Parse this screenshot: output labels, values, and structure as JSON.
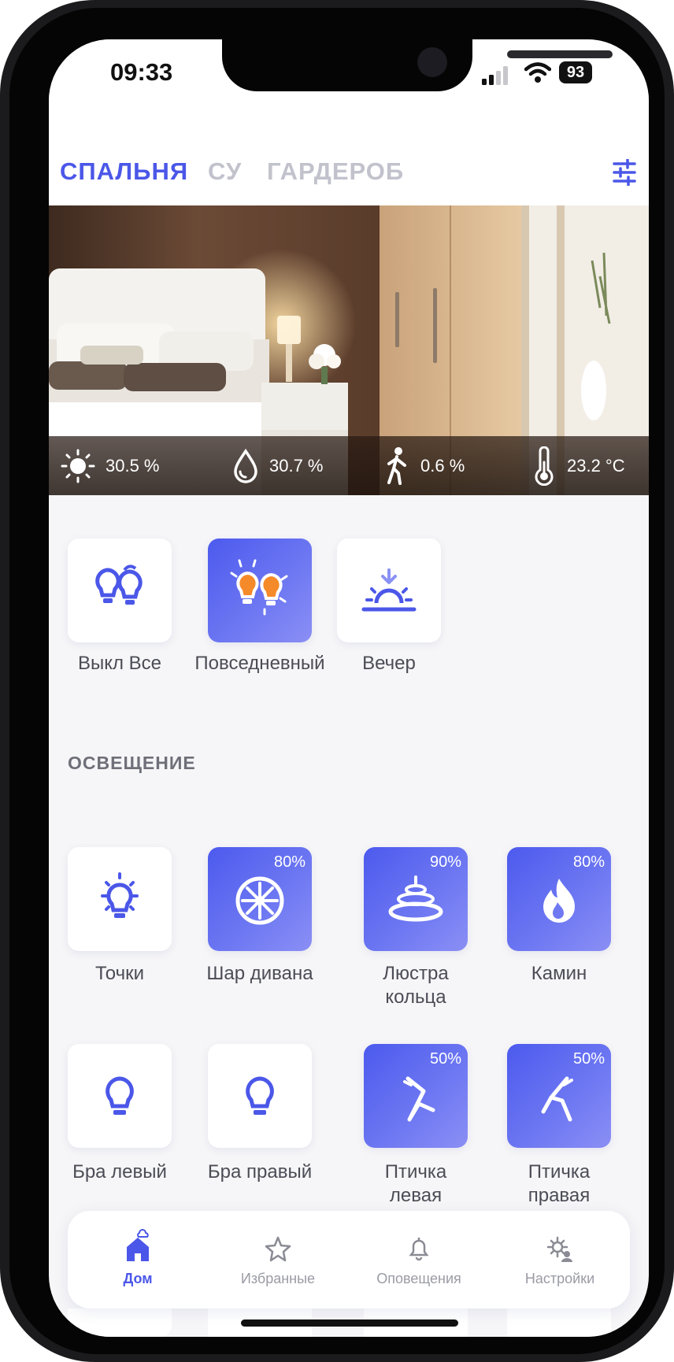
{
  "status_bar": {
    "time": "09:33",
    "battery": "93"
  },
  "tabs": [
    {
      "label": "СПАЛЬНЯ",
      "active": true
    },
    {
      "label": "СУ",
      "active": false
    },
    {
      "label": "ГАРДЕРОБ",
      "active": false
    }
  ],
  "sensors": [
    {
      "icon": "sun-icon",
      "value": "30.5 %"
    },
    {
      "icon": "drop-icon",
      "value": "30.7 %"
    },
    {
      "icon": "walking-person-icon",
      "value": "0.6 %"
    },
    {
      "icon": "thermometer-icon",
      "value": "23.2 °C"
    }
  ],
  "scenes": [
    {
      "icon": "bulbs-off-icon",
      "label": "Выкл Все",
      "active": false
    },
    {
      "icon": "bulbs-on-icon",
      "label": "Повседневный",
      "active": true
    },
    {
      "icon": "sunset-icon",
      "label": "Вечер",
      "active": false
    }
  ],
  "lighting_title": "ОСВЕЩЕНИЕ",
  "lights": [
    {
      "icon": "bulb-rays-icon",
      "label": "Точки",
      "level": "",
      "on": false
    },
    {
      "icon": "sphere-lamp-icon",
      "label": "Шар дивана",
      "level": "80%",
      "on": true
    },
    {
      "icon": "ring-chandelier-icon",
      "label": "Люстра кольца",
      "level": "90%",
      "on": true
    },
    {
      "icon": "flame-icon",
      "label": "Камин",
      "level": "80%",
      "on": true
    },
    {
      "icon": "bulb-icon",
      "label": "Бра левый",
      "level": "",
      "on": false
    },
    {
      "icon": "bulb-icon",
      "label": "Бра правый",
      "level": "",
      "on": false
    },
    {
      "icon": "bird-lamp-left-icon",
      "label": "Птичка левая",
      "level": "50%",
      "on": true
    },
    {
      "icon": "bird-lamp-right-icon",
      "label": "Птичка правая",
      "level": "50%",
      "on": true
    }
  ],
  "nav": [
    {
      "icon": "home-icon",
      "label": "Дом",
      "active": true
    },
    {
      "icon": "star-icon",
      "label": "Избранные",
      "active": false
    },
    {
      "icon": "bell-icon",
      "label": "Оповещения",
      "active": false
    },
    {
      "icon": "gear-user-icon",
      "label": "Настройки",
      "active": false
    }
  ],
  "colors": {
    "accent": "#4b57e8",
    "tile_on": "#5763ef",
    "background": "#f6f6f8",
    "inactive_tab": "#c1c2cc",
    "warm_bulb": "#f58a2a"
  }
}
